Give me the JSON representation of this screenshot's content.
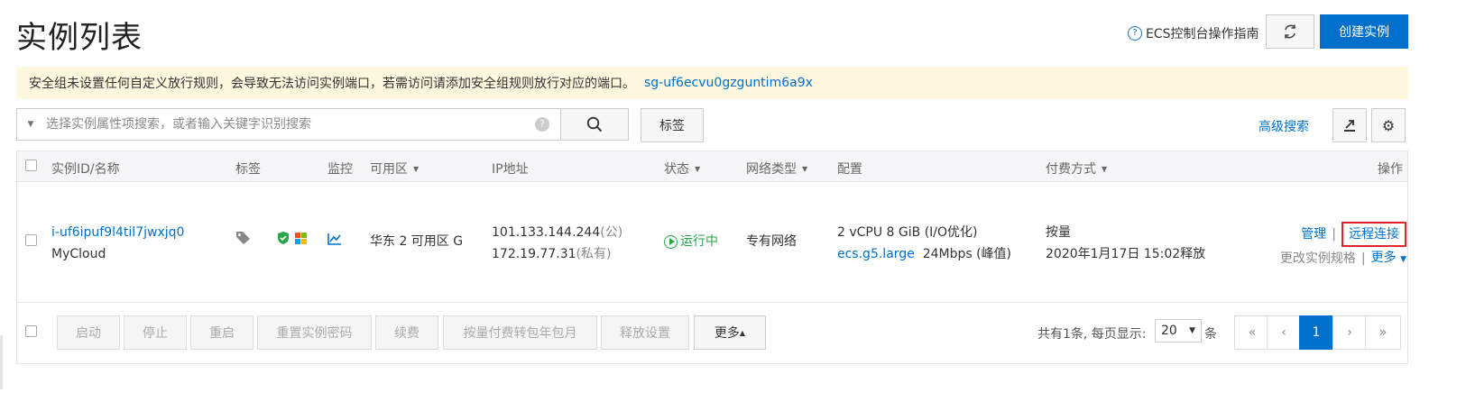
{
  "page": {
    "title": "实例列表",
    "guide_link": "ECS控制台操作指南",
    "create_button": "创建实例"
  },
  "warning": {
    "text": "安全组未设置任何自定义放行规则，会导致无法访问实例端口，若需访问请添加安全组规则放行对应的端口。",
    "security_group": "sg-uf6ecvu0gzguntim6a9x"
  },
  "search": {
    "placeholder": "选择实例属性项搜索，或者输入关键字识别搜索",
    "tag_button": "标签",
    "advanced": "高级搜索"
  },
  "table": {
    "headers": {
      "id_name": "实例ID/名称",
      "tags": "标签",
      "monitor": "监控",
      "zone": "可用区",
      "ip": "IP地址",
      "status": "状态",
      "network": "网络类型",
      "config": "配置",
      "billing": "付费方式",
      "actions": "操作"
    },
    "rows": [
      {
        "id": "i-uf6ipuf9l4til7jwxjq0",
        "name": "MyCloud",
        "zone": "华东 2 可用区 G",
        "public_ip": "101.133.144.244",
        "public_suffix": "(公)",
        "private_ip": "172.19.77.31",
        "private_suffix": "(私有)",
        "status": "运行中",
        "network": "专有网络",
        "config_line1": "2 vCPU 8 GiB (I/O优化)",
        "instance_type": "ecs.g5.large",
        "bandwidth": "24Mbps (峰值)",
        "billing": "按量",
        "release_time": "2020年1月17日 15:02释放",
        "action_manage": "管理",
        "action_remote": "远程连接",
        "action_change_spec": "更改实例规格",
        "action_more": "更多"
      }
    ]
  },
  "footer": {
    "buttons": [
      "启动",
      "停止",
      "重启",
      "重置实例密码",
      "续费",
      "按量付费转包年包月",
      "释放设置"
    ],
    "more": "更多",
    "total_text": "共有1条, 每页显示:",
    "page_size": "20",
    "unit": "条",
    "pager": {
      "first": "«",
      "prev": "‹",
      "current": "1",
      "next": "›",
      "last": "»"
    }
  }
}
